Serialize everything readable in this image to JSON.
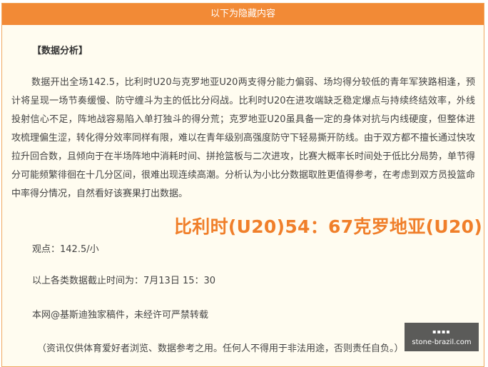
{
  "header": {
    "title": "以下为隐藏内容"
  },
  "section": {
    "title": "【数据分析】"
  },
  "analysis": {
    "paragraph": "数据开出全场142.5，比利时U20与克罗地亚U20两支得分能力偏弱、场均得分较低的青年军狭路相逢，预计将呈现一场节奏缓慢、防守缠斗为主的低比分闷战。比利时U20在进攻端缺乏稳定爆点与持续终结效率，外线投射信心不足，阵地战容易陷入单打独斗的得分荒；克罗地亚U20虽具备一定的身体对抗与内线硬度，但整体进攻梳理偏生涩，转化得分效率同样有限，难以在青年级别高强度防守下轻易撕开防线。由于双方都不擅长通过快攻拉升回合数，且倾向于在半场阵地中消耗时间、拼抢篮板与二次进攻，比赛大概率长时间处于低比分局势，单节得分可能频繁徘徊在十几分区间，很难出现连续高潮。分析认为小比分数据取胜更值得参考，在考虑到双方员投篮命中率得分情况，自然看好该赛果打出数据。"
  },
  "result": {
    "score_text": "比利时(U20)54：67克罗地亚(U20)"
  },
  "viewpoint": {
    "text": "观点：142.5/小"
  },
  "cutoff": {
    "text": "以上各类数据截止时间为：7月13日 15：30"
  },
  "copyright": {
    "text": "本网@基斯迪独家稿件，未经许可严禁转载"
  },
  "disclaimer": {
    "text": "（资讯仅供体育爱好者浏览、数据参考之用。任何人不得用于非法用途，否则责任自负。）"
  },
  "watermark": {
    "text": "stone-brazil.com"
  }
}
